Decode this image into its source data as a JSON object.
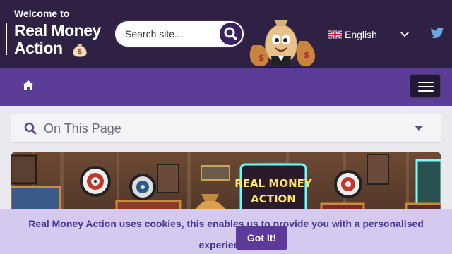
{
  "header": {
    "welcome_text": "Welcome to",
    "brand_line1": "Real Money",
    "brand_line2": "Action",
    "search_placeholder": "Search site...",
    "language_label": "English",
    "icons": [
      "search-icon",
      "uk-flag-icon",
      "chevron-down-icon",
      "twitter-icon",
      "money-bag-icon"
    ]
  },
  "nav": {
    "home_icon": "home-icon",
    "menu_icon": "hamburger-menu-icon"
  },
  "toc": {
    "title": "On This Page"
  },
  "hero": {
    "sign_line1": "REAL MONEY",
    "sign_line2": "ACTION"
  },
  "cookie": {
    "message": "Real Money Action uses cookies, this enables us to provide you with a personalised experience.",
    "button_label": "Got It!"
  },
  "colors": {
    "header_bg": "#2f2143",
    "nav_bg": "#5b3d98",
    "cookie_bg": "#d6c9ef",
    "accent": "#5e3a9a"
  }
}
